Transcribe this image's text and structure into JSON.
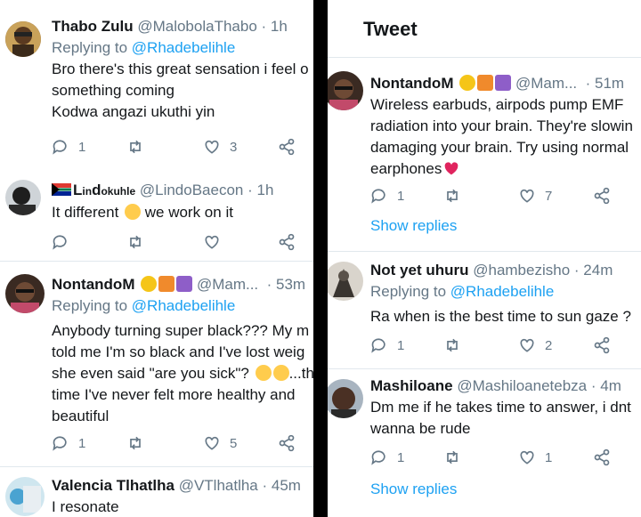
{
  "left": {
    "tweets": [
      {
        "name": "Thabo Zulu",
        "handle": "@MalobolaThabo",
        "time": "· 1h",
        "reply_prefix": "Replying to ",
        "reply_to": "@Rhadebelihle",
        "lines": [
          "Bro there's this great sensation i feel o",
          "something coming",
          "Kodwa angazi ukuthi yin"
        ],
        "replies": "1",
        "retweets": "",
        "likes": "3"
      },
      {
        "name_prefix": "L",
        "name_small1": "in",
        "name_mid": "d",
        "name_small2": "okuhle",
        "handle": "@LindoBaecon",
        "time": "· 1h",
        "line_before": "It different ",
        "line_after": " we work on it",
        "replies": "",
        "retweets": "",
        "likes": ""
      },
      {
        "name": "NontandoM",
        "handle": "@Mam...",
        "time": "· 53m",
        "reply_prefix": "Replying to ",
        "reply_to": "@Rhadebelihle",
        "lines": [
          "Anybody turning super black??? My m",
          "told me I'm so black and I've lost weig",
          "she even said \"are you sick\"? ",
          "time I've never felt more healthy and",
          "beautiful"
        ],
        "line3_tail": "...th",
        "replies": "1",
        "retweets": "",
        "likes": "5"
      },
      {
        "name": "Valencia Tlhatlha",
        "handle": "@VTlhatlha",
        "time": "· 45m",
        "lines": [
          "I resonate"
        ]
      }
    ]
  },
  "right": {
    "header_title": "Tweet",
    "tweets": [
      {
        "name": "NontandoM",
        "handle": "@Mam...",
        "time": "· 51m",
        "lines": [
          "Wireless earbuds, airpods pump EMF",
          "radiation into your brain. They're slowin",
          "damaging your brain. Try using normal",
          "earphones"
        ],
        "replies": "1",
        "retweets": "",
        "likes": "7",
        "show_replies": "Show replies"
      },
      {
        "name": "Not yet uhuru",
        "handle": "@hambezisho",
        "time": "· 24m",
        "reply_prefix": "Replying to ",
        "reply_to": "@Rhadebelihle",
        "lines": [
          "Ra when is the best time to sun gaze ?"
        ],
        "replies": "1",
        "retweets": "",
        "likes": "2"
      },
      {
        "name": "Mashiloane",
        "handle": "@Mashiloanetebza",
        "time": "· 4m",
        "lines": [
          "Dm me if he takes time to answer, i dnt",
          "wanna be rude"
        ],
        "replies": "1",
        "retweets": "",
        "likes": "1",
        "show_replies": "Show replies"
      }
    ]
  },
  "colors": {
    "link": "#1da1f2",
    "muted": "#657786",
    "text": "#14171a",
    "heart": "#e0245e"
  },
  "icons": [
    "reply-icon",
    "retweet-icon",
    "like-icon",
    "share-icon",
    "joy-emoji",
    "sweat-smile-emoji",
    "crying-emoji",
    "red-heart-emoji",
    "sunflower-emoji",
    "sunrise-emoji",
    "pisces-emoji",
    "south-africa-flag"
  ]
}
